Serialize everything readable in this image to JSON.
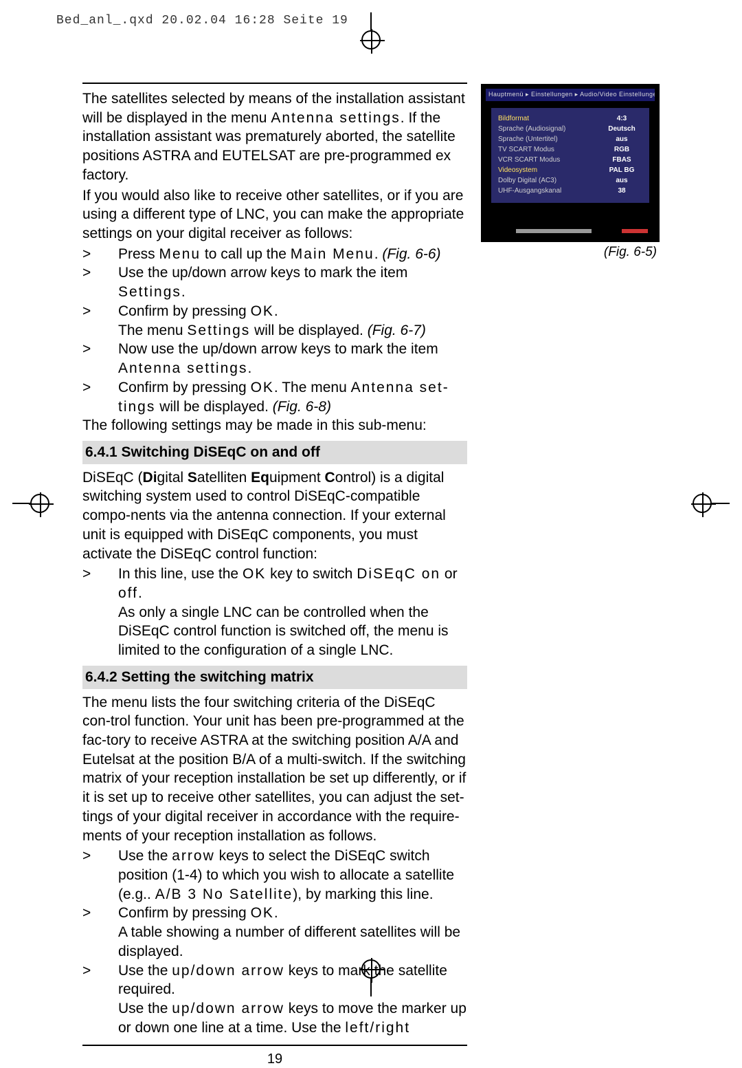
{
  "print_header": "Bed_anl_.qxd  20.02.04  16:28  Seite 19",
  "page_number": "19",
  "body": {
    "intro1a": "The satellites selected by means of the installation assistant will be displayed in the menu ",
    "intro1b": "Antenna settings",
    "intro1c": ". If the installation assistant was prematurely aborted, the satellite positions ASTRA and EUTELSAT are pre-programmed ex factory.",
    "intro2": "If you would also like to receive other satellites, or if you are using a different type of LNC, you can make the appropriate settings on your digital receiver as follows:",
    "step1a": "Press ",
    "step1b": "Menu",
    "step1c": " to call up the ",
    "step1d": "Main Menu",
    "step1e": ". ",
    "step1f": "(Fig. 6-6)",
    "step2a": "Use the up/down arrow keys to mark the item ",
    "step2b": "Settings",
    "step2c": ".",
    "step3a": "Confirm by pressing ",
    "step3b": "OK",
    "step3c": ".",
    "step3d": "The menu ",
    "step3e": "Settings",
    "step3f": " will be displayed. ",
    "step3g": "(Fig. 6-7)",
    "step4a": "Now use the up/down arrow keys to mark the item ",
    "step4b": "Antenna settings",
    "step4c": ".",
    "step5a": "Confirm by pressing ",
    "step5b": "OK",
    "step5c": ".  The menu ",
    "step5d": "Antenna set-tings",
    "step5e": " will be displayed. ",
    "step5f": "(Fig. 6-8)",
    "outro1": "The following settings may be made in this sub-menu:",
    "h641": "6.4.1 Switching DiSEqC on and off",
    "p641a": "DiSEqC (",
    "p641b": "Di",
    "p641c": "gital ",
    "p641d": "S",
    "p641e": "atelliten ",
    "p641f": "Eq",
    "p641g": "uipment ",
    "p641h": "C",
    "p641i": "ontrol) is a digital switching system used to control DiSEqC-compatible compo-nents via the antenna connection. If your external unit is equipped with DiSEqC components, you must activate the DiSEqC control function:",
    "p641_li1a": "In this line, use the ",
    "p641_li1b": "OK",
    "p641_li1c": " key to switch ",
    "p641_li1d": "DiSEqC on",
    "p641_li1e": " or ",
    "p641_li1f": "off",
    "p641_li1g": ".",
    "p641_li2": "As only a single LNC can be controlled when the DiSEqC control function is switched off, the menu is limited to the configuration of a single LNC.",
    "h642": "6.4.2 Setting the switching matrix",
    "p642a": "The menu lists the four switching criteria of the DiSEqC con-trol function. Your unit has been pre-programmed at the fac-tory to receive ASTRA at the switching position A/A and Eutelsat at the position B/A of a multi-switch. If the switching matrix of your reception installation be set up differently, or if it is set up to receive other satellites, you can adjust the set-tings of your digital receiver in accordance with the require-ments of your reception installation as follows.",
    "p642_li1a": "Use the ",
    "p642_li1b": "arrow",
    "p642_li1c": " keys to select the DiSEqC switch position (1-4) to which you wish to allocate a satellite (e.g.. ",
    "p642_li1d": "A/B 3 No Satellite",
    "p642_li1e": "), by marking this line.",
    "p642_li2a": "Confirm by pressing ",
    "p642_li2b": "OK",
    "p642_li2c": ".",
    "p642_li2d": "A table showing a number of different satellites will be displayed.",
    "p642_li3a": "Use the ",
    "p642_li3b": "up/down arrow",
    "p642_li3c": " keys to mark the satellite required.",
    "p642_li3d": "Use the ",
    "p642_li3e": "up/down arrow",
    "p642_li3f": " keys to move the marker up or down one line at a time. Use the ",
    "p642_li3g": "left/right"
  },
  "figure": {
    "caption": "(Fig. 6-5)",
    "titlebar": "Hauptmenü ▸ Einstellungen ▸ Audio/Video Einstellungen",
    "rows": [
      {
        "label": "Bildformat",
        "value": "4:3"
      },
      {
        "label": "Sprache (Audiosignal)",
        "value": "Deutsch"
      },
      {
        "label": "Sprache (Untertitel)",
        "value": "aus"
      },
      {
        "label": "TV SCART Modus",
        "value": "RGB"
      },
      {
        "label": "VCR SCART Modus",
        "value": "FBAS"
      },
      {
        "label": "Videosystem",
        "value": "PAL BG"
      },
      {
        "label": "Dolby Digital (AC3)",
        "value": "aus"
      },
      {
        "label": "UHF-Ausgangskanal",
        "value": "38"
      }
    ]
  }
}
